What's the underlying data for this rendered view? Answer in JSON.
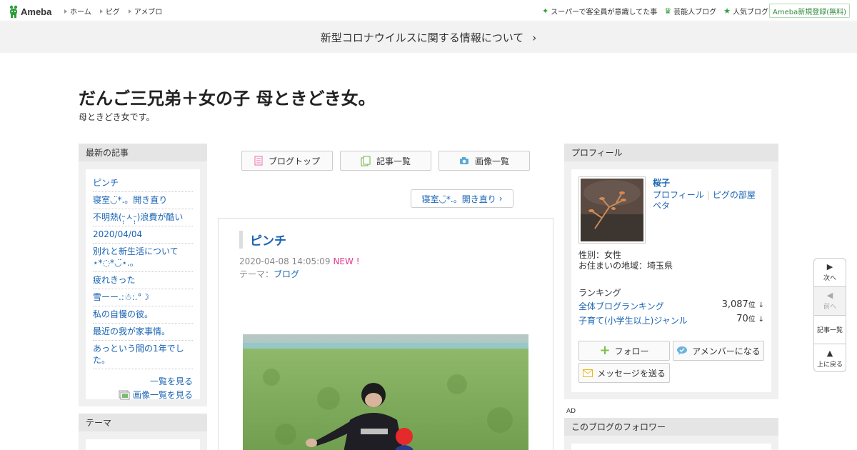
{
  "topbar": {
    "logo": "Ameba",
    "nav": [
      "ホーム",
      "ピグ",
      "アメブロ"
    ],
    "right_links": [
      {
        "icon": "sparkle-icon",
        "label": "スーパーで客全員が意識してた事"
      },
      {
        "icon": "crown-icon",
        "label": "芸能人ブログ"
      },
      {
        "icon": "star-icon",
        "label": "人気ブログ"
      }
    ],
    "signup": "Ameba新規登録(無料)"
  },
  "announcement": "新型コロナウイルスに関する情報について",
  "blog": {
    "title": "だんご三兄弟＋女の子 母ときどき女。",
    "description": "母ときどき女です。"
  },
  "left_sidebar": {
    "recent_heading": "最新の記事",
    "recent_items": [
      "ピンチ",
      "寝室◡̈*.。開き直り",
      "不明熱(ᵕ̩̩ㅅᵕ̩̩)浪費が酷い",
      "2020/04/04",
      "別れと新生活について⋆*◌*◡̈⋆.。",
      "疲れきった",
      "雪ーー.:☃︎:.°☽",
      "私の自慢の彼。",
      "最近の我が家事情。",
      "あっという間の1年でした。"
    ],
    "see_all": "一覧を見る",
    "see_images": "画像一覧を見る",
    "theme_heading": "テーマ"
  },
  "center": {
    "buttons": {
      "blog_top": "ブログトップ",
      "article_list": "記事一覧",
      "image_list": "画像一覧"
    },
    "next_article": "寝室◡̈*.。開き直り",
    "article": {
      "title": "ピンチ",
      "date": "2020-04-08 14:05:09",
      "new_badge": "NEW !",
      "theme_label": "テーマ：",
      "theme_value": "ブログ"
    }
  },
  "right_sidebar": {
    "profile_heading": "プロフィール",
    "name": "桜子",
    "link_profile": "プロフィール",
    "link_pig_room": "ピグの部屋",
    "link_peta": "ペタ",
    "gender": "性別：女性",
    "location": "お住まいの地域：埼玉県",
    "ranking_heading": "ランキング",
    "rankings": [
      {
        "label": "全体ブログランキング",
        "rank": "3,087",
        "unit": "位",
        "trend": "↓"
      },
      {
        "label": "子育て(小学生以上)ジャンル",
        "rank": "70",
        "unit": "位",
        "trend": "↓"
      }
    ],
    "follow": "フォロー",
    "amember": "アメンバーになる",
    "message": "メッセージを送る",
    "ad_label": "AD",
    "followers_heading": "このブログのフォロワー"
  },
  "pager": {
    "next": "次へ",
    "prev": "前へ",
    "list": "記事一覧",
    "top": "上に戻る"
  },
  "colors": {
    "link": "#1a64b4",
    "brand_green": "#2e9e3a",
    "new_badge": "#e8388a"
  }
}
